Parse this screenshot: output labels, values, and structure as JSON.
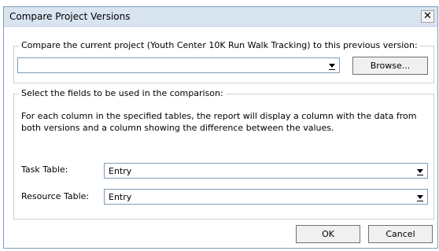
{
  "dialog": {
    "title": "Compare Project Versions",
    "close_glyph": "✕"
  },
  "version_group": {
    "legend": "Compare the current project (Youth Center 10K Run Walk Tracking) to this previous version:",
    "version_value": "",
    "browse_label": "Browse..."
  },
  "fields_group": {
    "legend": "Select the fields to be used in the comparison:",
    "description": "For each column in the specified tables, the report will display a column with the data from both versions and a column showing the difference between the values.",
    "task_table_label": "Task Table:",
    "task_table_value": "Entry",
    "resource_table_label": "Resource Table:",
    "resource_table_value": "Entry"
  },
  "footer": {
    "ok_label": "OK",
    "cancel_label": "Cancel"
  }
}
